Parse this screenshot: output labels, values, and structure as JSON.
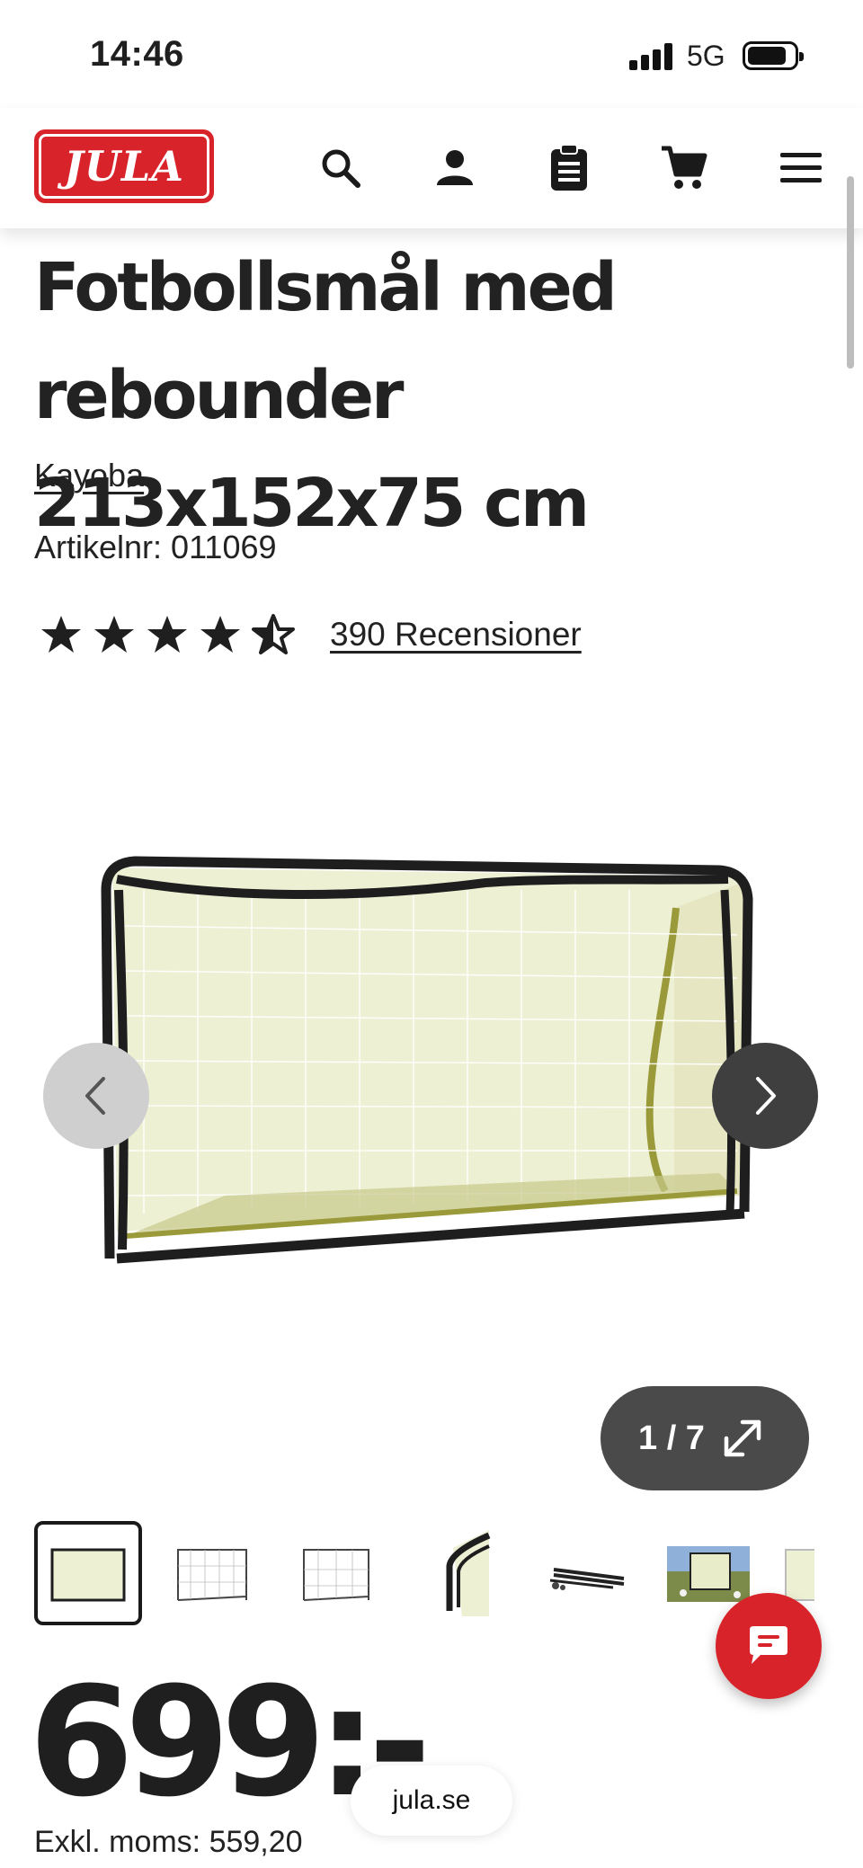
{
  "status_bar": {
    "time": "14:46",
    "network": "5G"
  },
  "header": {
    "logo_text": "JULA",
    "brand_color": "#d8232a",
    "icons": [
      "search-icon",
      "account-icon",
      "clipboard-icon",
      "cart-icon",
      "menu-icon"
    ]
  },
  "product": {
    "title_line1": "Fotbollsmål med",
    "title_line2": "rebounder 213x152x75 cm",
    "brand": "Kayoba",
    "article_label": "Artikelnr:",
    "article_number": "011069",
    "rating": 4.5,
    "rating_max": 5,
    "reviews_label": "390 Recensioner"
  },
  "gallery": {
    "counter": "1 / 7",
    "current_index": 1,
    "total_images": 7,
    "thumbnail_count": 7
  },
  "pricing": {
    "price": "699:-",
    "excl_vat": "Exkl. moms: 559,20"
  },
  "browser": {
    "url": "jula.se"
  }
}
